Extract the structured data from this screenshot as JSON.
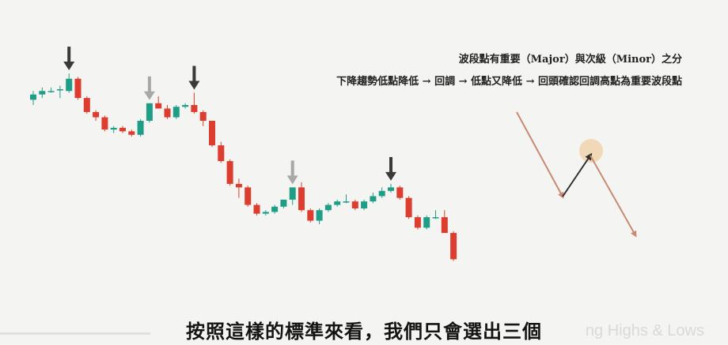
{
  "notes": {
    "line1": "波段點有重要（Major）與次級（Minor）之分",
    "line2": "下降趨勢低點降低 → 回調 → 低點又降低 → 回頭確認回調高點為重要波段點"
  },
  "subtitle": "按照這樣的標準來看，我們只會選出三個",
  "watermark": "ng Highs & Lows",
  "colors": {
    "background": "#f4f4f2",
    "bullish": "#1e9e87",
    "bearish": "#dd3d2f",
    "major_arrow": "#3a3a3a",
    "minor_arrow": "#a8a8a8",
    "diagram_down_line": "#c98a72",
    "diagram_up_line": "#2f2f2f",
    "diagram_highlight": "#f0d3ae"
  },
  "chart_data": {
    "type": "candlestick",
    "candles": [
      {
        "o": 62,
        "h": 67,
        "l": 59,
        "c": 65
      },
      {
        "o": 65,
        "h": 69,
        "l": 63,
        "c": 67
      },
      {
        "o": 67,
        "h": 69,
        "l": 66,
        "c": 67
      },
      {
        "o": 68,
        "h": 70,
        "l": 63,
        "c": 68
      },
      {
        "o": 67,
        "h": 77,
        "l": 66,
        "c": 74
      },
      {
        "o": 74,
        "h": 75,
        "l": 62,
        "c": 63
      },
      {
        "o": 63,
        "h": 64,
        "l": 54,
        "c": 55
      },
      {
        "o": 55,
        "h": 56,
        "l": 50,
        "c": 52
      },
      {
        "o": 52,
        "h": 53,
        "l": 44,
        "c": 45
      },
      {
        "o": 45,
        "h": 47,
        "l": 43,
        "c": 46
      },
      {
        "o": 46,
        "h": 47,
        "l": 43,
        "c": 44
      },
      {
        "o": 44,
        "h": 45,
        "l": 41,
        "c": 42
      },
      {
        "o": 42,
        "h": 51,
        "l": 41,
        "c": 50
      },
      {
        "o": 50,
        "h": 60,
        "l": 49,
        "c": 60
      },
      {
        "o": 60,
        "h": 64,
        "l": 57,
        "c": 57
      },
      {
        "o": 57,
        "h": 59,
        "l": 51,
        "c": 52
      },
      {
        "o": 52,
        "h": 59,
        "l": 51,
        "c": 58
      },
      {
        "o": 58,
        "h": 60,
        "l": 57,
        "c": 59
      },
      {
        "o": 59,
        "h": 66,
        "l": 54,
        "c": 55
      },
      {
        "o": 55,
        "h": 56,
        "l": 47,
        "c": 50
      },
      {
        "o": 50,
        "h": 50,
        "l": 35,
        "c": 36
      },
      {
        "o": 36,
        "h": 38,
        "l": 26,
        "c": 27
      },
      {
        "o": 27,
        "h": 28,
        "l": 13,
        "c": 14
      },
      {
        "o": 14,
        "h": 17,
        "l": 6,
        "c": 12
      },
      {
        "o": 12,
        "h": 13,
        "l": 1,
        "c": 2
      },
      {
        "o": 2,
        "h": 3,
        "l": -4,
        "c": -3
      },
      {
        "o": -3,
        "h": -1,
        "l": -4,
        "c": -2
      },
      {
        "o": -2,
        "h": 2,
        "l": -3,
        "c": 1
      },
      {
        "o": 1,
        "h": 5,
        "l": 0,
        "c": 5
      },
      {
        "o": 5,
        "h": 12,
        "l": 2,
        "c": 12
      },
      {
        "o": 12,
        "h": 15,
        "l": -2,
        "c": -1
      },
      {
        "o": -1,
        "h": 0,
        "l": -8,
        "c": -7
      },
      {
        "o": -7,
        "h": 0,
        "l": -9,
        "c": -1
      },
      {
        "o": -1,
        "h": 3,
        "l": -2,
        "c": 2
      },
      {
        "o": 2,
        "h": 5,
        "l": 1,
        "c": 4
      },
      {
        "o": 4,
        "h": 8,
        "l": 3,
        "c": 4
      },
      {
        "o": 4,
        "h": 5,
        "l": -1,
        "c": 0
      },
      {
        "o": 0,
        "h": 5,
        "l": -1,
        "c": 4
      },
      {
        "o": 4,
        "h": 9,
        "l": 3,
        "c": 7
      },
      {
        "o": 7,
        "h": 12,
        "l": 6,
        "c": 10
      },
      {
        "o": 10,
        "h": 14,
        "l": 9,
        "c": 12
      },
      {
        "o": 12,
        "h": 13,
        "l": 5,
        "c": 6
      },
      {
        "o": 6,
        "h": 7,
        "l": -6,
        "c": -5
      },
      {
        "o": -5,
        "h": -4,
        "l": -12,
        "c": -11
      },
      {
        "o": -11,
        "h": -4,
        "l": -12,
        "c": -5
      },
      {
        "o": -5,
        "h": -1,
        "l": -6,
        "c": -5
      },
      {
        "o": -5,
        "h": -1,
        "l": -12,
        "c": -14
      },
      {
        "o": -14,
        "h": -13,
        "l": -30,
        "c": -29
      }
    ],
    "swing_markers": [
      {
        "candle": 4,
        "type": "major"
      },
      {
        "candle": 13,
        "type": "minor"
      },
      {
        "candle": 18,
        "type": "major"
      },
      {
        "candle": 29,
        "type": "minor"
      },
      {
        "candle": 40,
        "type": "major"
      }
    ]
  }
}
